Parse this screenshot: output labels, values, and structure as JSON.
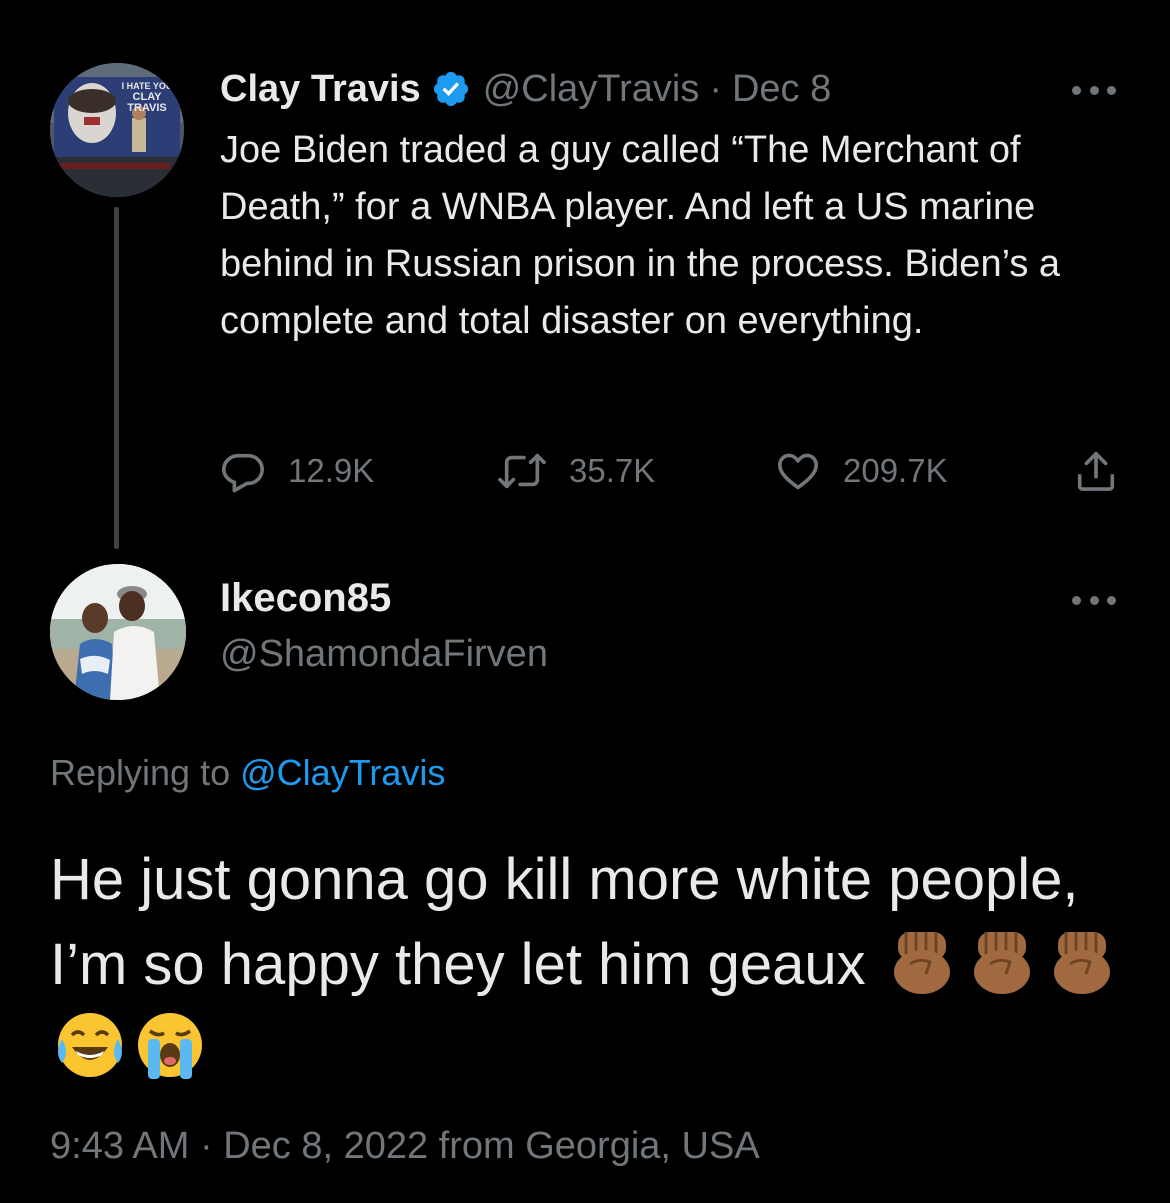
{
  "parent_tweet": {
    "display_name": "Clay Travis",
    "handle": "@ClayTravis",
    "separator": "·",
    "date": "Dec 8",
    "text": "Joe Biden traded a guy called “The Merchant of Death,” for a WNBA player. And left a US marine behind in Russian prison in the process. Biden’s a complete and total disaster on everything.",
    "avatar_sign_text": [
      "I HATE YOU",
      "CLAY",
      "TRAVIS"
    ],
    "metrics": {
      "replies": "12.9K",
      "retweets": "35.7K",
      "likes": "209.7K"
    }
  },
  "reply_tweet": {
    "display_name": "Ikecon85",
    "handle": "@ShamondaFirven",
    "replying_prefix": "Replying to",
    "replying_to": "@ClayTravis",
    "text": "He just gonna go kill more white people, I’m so happy they let him geaux",
    "emojis": [
      "raised-fist-medium-dark",
      "raised-fist-medium-dark",
      "raised-fist-medium-dark",
      "face-with-tears-of-joy",
      "loudly-crying-face"
    ],
    "timestamp": "9:43 AM · Dec 8, 2022 from Georgia, USA"
  },
  "icons": {
    "verified": "verified-badge-icon",
    "more": "more-options-icon",
    "reply": "reply-icon",
    "retweet": "retweet-icon",
    "like": "heart-icon",
    "share": "share-icon"
  },
  "colors": {
    "background": "#000000",
    "primary_text": "#e7e9ea",
    "secondary_text": "#71767b",
    "accent": "#1d9bf0",
    "thread_line": "#3e4144"
  }
}
